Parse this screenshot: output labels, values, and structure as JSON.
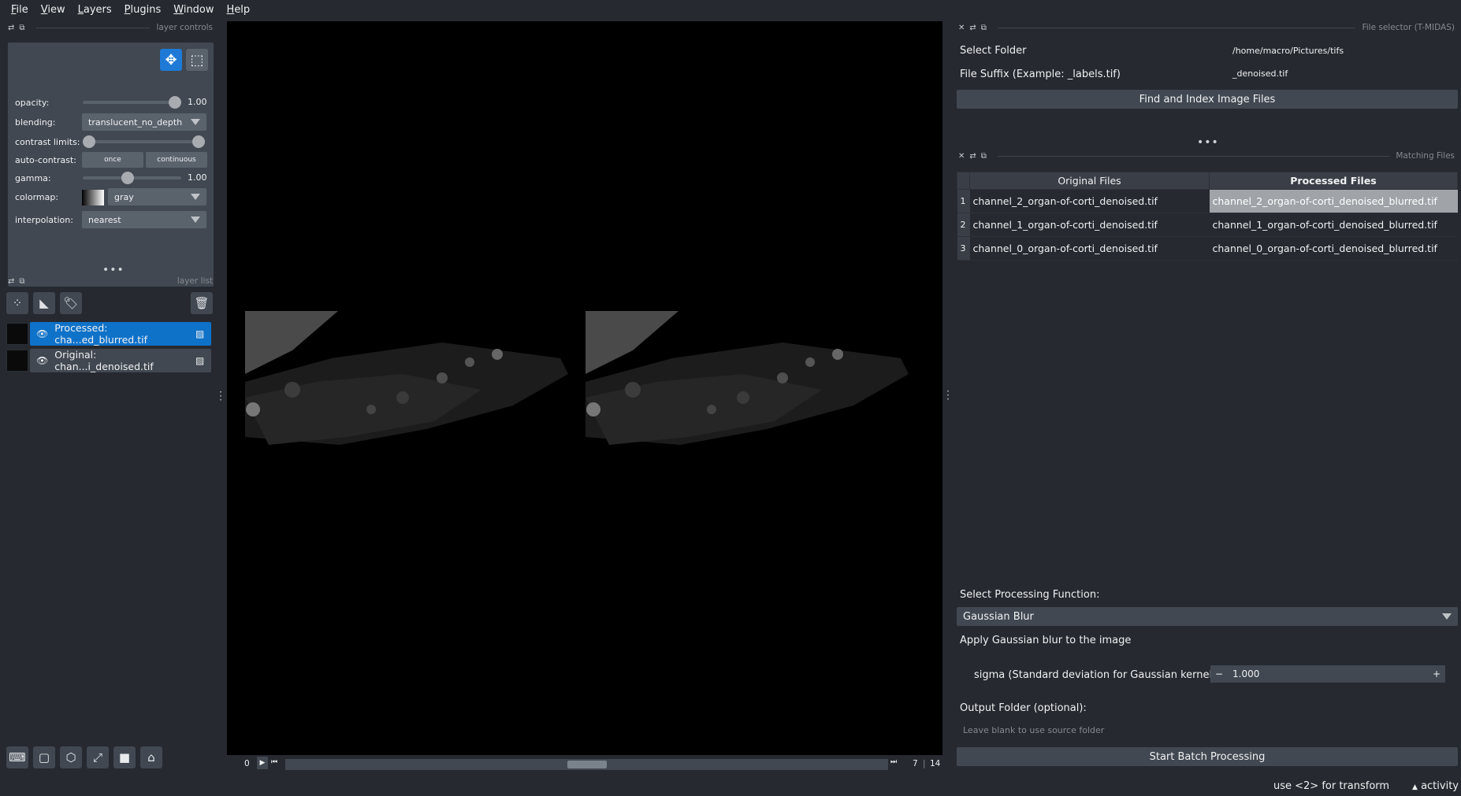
{
  "menu": [
    {
      "label": "File",
      "u": "F",
      "rest": "ile"
    },
    {
      "label": "View",
      "u": "V",
      "rest": "iew"
    },
    {
      "label": "Layers",
      "u": "L",
      "rest": "ayers"
    },
    {
      "label": "Plugins",
      "u": "P",
      "rest": "lugins"
    },
    {
      "label": "Window",
      "u": "W",
      "rest": "indow"
    },
    {
      "label": "Help",
      "u": "H",
      "rest": "elp"
    }
  ],
  "layer_controls": {
    "title": "layer controls",
    "opacity_label": "opacity:",
    "opacity_value": "1.00",
    "opacity_level": 1.0,
    "blending_label": "blending:",
    "blending_value": "translucent_no_depth",
    "contrast_label": "contrast limits:",
    "autocontrast_label": "auto-contrast:",
    "once_label": "once",
    "continuous_label": "continuous",
    "gamma_label": "gamma:",
    "gamma_value": "1.00",
    "gamma_level": 0.45,
    "colormap_label": "colormap:",
    "colormap_value": "gray",
    "interpolation_label": "interpolation:",
    "interpolation_value": "nearest"
  },
  "layer_list": {
    "title": "layer list",
    "layers": [
      {
        "name": "Processed: cha...ed_blurred.tif",
        "selected": true
      },
      {
        "name": "Original: chan...i_denoised.tif",
        "selected": false
      }
    ]
  },
  "dims": {
    "start": "0",
    "current": "7",
    "total": "14",
    "position_fraction": 0.5
  },
  "file_selector": {
    "title": "File selector (T-MIDAS)",
    "folder_label": "Select Folder",
    "folder_value": "/home/macro/Pictures/tifs",
    "suffix_label": "File Suffix (Example: _labels.tif)",
    "suffix_value": "_denoised.tif",
    "find_button": "Find and Index Image Files"
  },
  "matching_files": {
    "title": "Matching Files",
    "col_original": "Original Files",
    "col_processed": "Processed Files",
    "rows": [
      {
        "n": "1",
        "original": "channel_2_organ-of-corti_denoised.tif",
        "processed": "channel_2_organ-of-corti_denoised_blurred.tif"
      },
      {
        "n": "2",
        "original": "channel_1_organ-of-corti_denoised.tif",
        "processed": "channel_1_organ-of-corti_denoised_blurred.tif"
      },
      {
        "n": "3",
        "original": "channel_0_organ-of-corti_denoised.tif",
        "processed": "channel_0_organ-of-corti_denoised_blurred.tif"
      }
    ]
  },
  "processing": {
    "function_label": "Select Processing Function:",
    "function_value": "Gaussian Blur",
    "description": "Apply Gaussian blur to the image",
    "sigma_label": "sigma (Standard deviation for Gaussian kernel):",
    "sigma_value": "1.000",
    "output_label": "Output Folder (optional):",
    "output_placeholder": "Leave blank to use source folder",
    "start_button": "Start Batch Processing"
  },
  "status": {
    "hint": "use <2> for transform",
    "activity": "activity"
  }
}
